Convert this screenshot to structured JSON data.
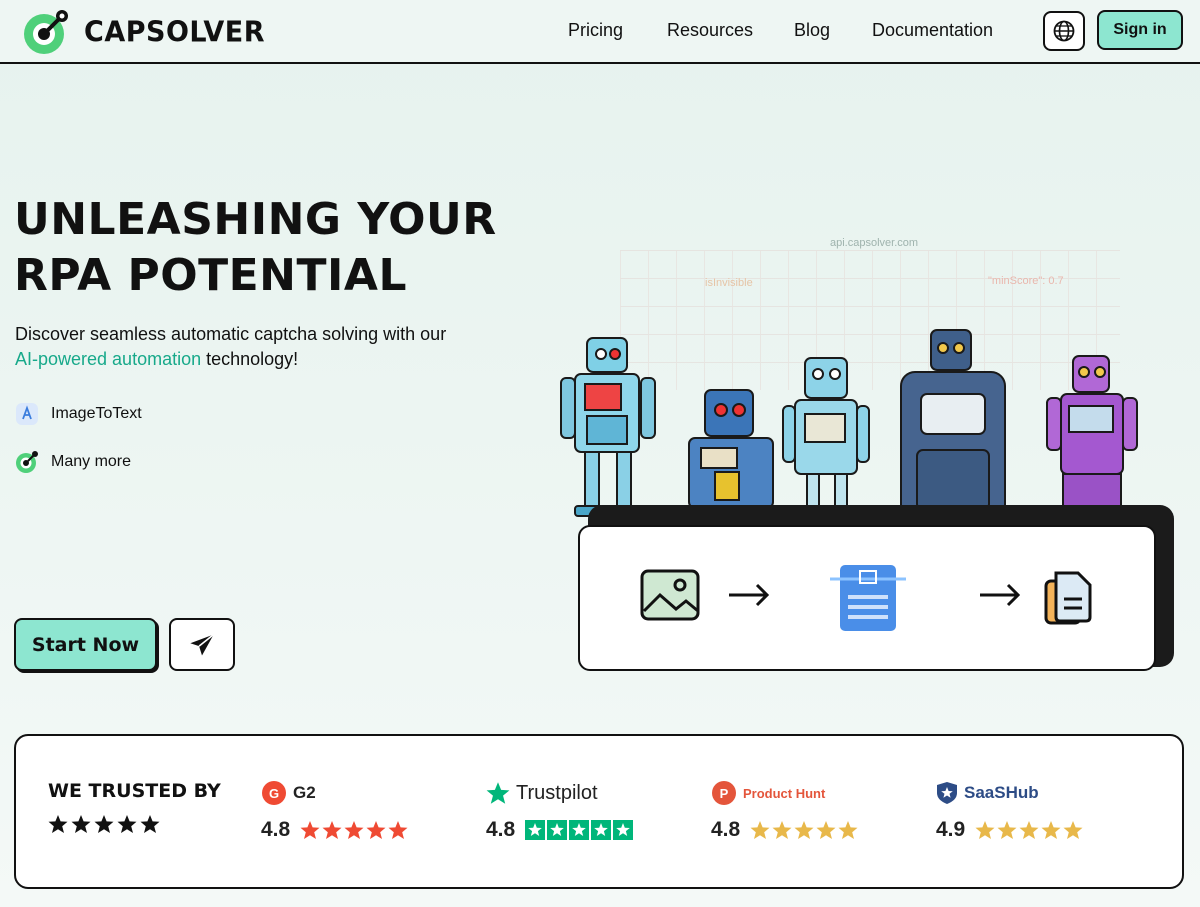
{
  "nav": {
    "brand": "CAPSOLVER",
    "links": [
      "Pricing",
      "Resources",
      "Blog",
      "Documentation"
    ],
    "sign_in": "Sign in"
  },
  "hero": {
    "title_line1": "UNLEASHING YOUR",
    "title_line2": "RPA POTENTIAL",
    "subtitle_before": "Discover seamless automatic captcha solving with our",
    "subtitle_highlight": "AI-powered automation",
    "subtitle_after": " technology!",
    "features": [
      {
        "label": "ImageToText",
        "icon": "image-to-text-icon"
      },
      {
        "label": "Many more",
        "icon": "capsolver-logo-icon"
      }
    ],
    "start_button": "Start Now"
  },
  "illustration": {
    "hints": [
      "api.capsolver.com",
      "isInvisible",
      "\"minScore\": 0.7"
    ]
  },
  "trust": {
    "title": "WE TRUSTED BY",
    "ratings": [
      {
        "brand": "G2",
        "score": "4.8",
        "stars": 5,
        "star_color": "#ef4a33"
      },
      {
        "brand": "Trustpilot",
        "score": "4.8",
        "stars": 5,
        "star_color": "#00b67a"
      },
      {
        "brand": "Product Hunt",
        "score": "4.8",
        "stars": 5,
        "star_color": "#e8b84a"
      },
      {
        "brand": "SaaSHub",
        "score": "4.9",
        "stars": 5,
        "star_color": "#e8b84a"
      }
    ]
  },
  "colors": {
    "accent": "#8de6d0",
    "highlight_text": "#17a98a",
    "logo_green": "#4fd07a"
  }
}
